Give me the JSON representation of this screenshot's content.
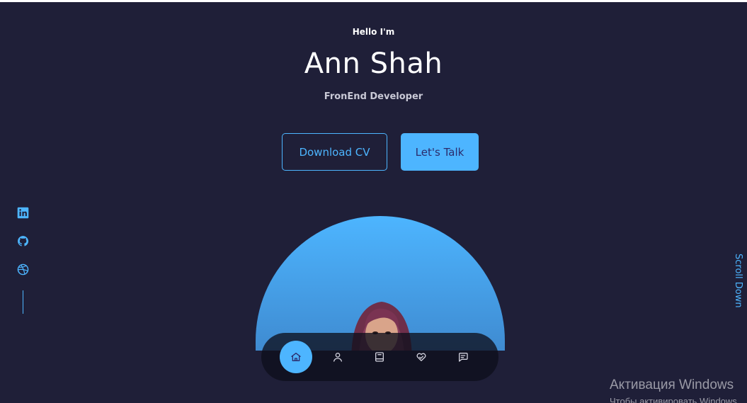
{
  "hero": {
    "greeting": "Hello I'm",
    "name": "Ann Shah",
    "role": "FronEnd Developer"
  },
  "cta": {
    "download_cv": "Download CV",
    "lets_talk": "Let's Talk"
  },
  "socials": [
    {
      "icon": "linkedin-icon"
    },
    {
      "icon": "github-icon"
    },
    {
      "icon": "dribbble-icon"
    }
  ],
  "scroll_label": "Scroll Down",
  "nav": {
    "items": [
      {
        "icon": "home-icon",
        "active": true
      },
      {
        "icon": "user-icon",
        "active": false
      },
      {
        "icon": "book-icon",
        "active": false
      },
      {
        "icon": "services-icon",
        "active": false
      },
      {
        "icon": "message-icon",
        "active": false
      }
    ]
  },
  "watermark": {
    "title": "Активация Windows",
    "subtitle": "Чтобы активировать Windows"
  },
  "colors": {
    "background": "#1f1f38",
    "accent": "#4db5ff",
    "text": "#ffffff",
    "muted": "#c9c9d6"
  }
}
